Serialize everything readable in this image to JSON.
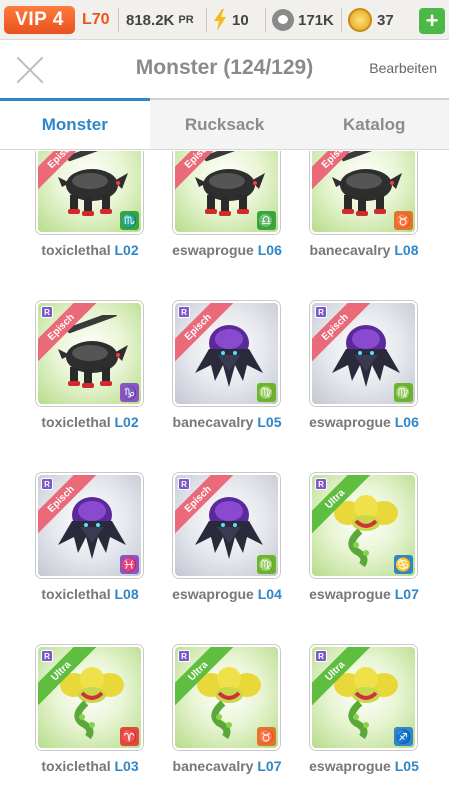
{
  "statusbar": {
    "vip": "VIP 4",
    "level": "L70",
    "power": "818.2K",
    "power_unit": "PR",
    "energy": "10",
    "food": "171K",
    "coins": "37",
    "add_label": "+"
  },
  "header": {
    "title": "Monster (124/129)",
    "edit_label": "Bearbeiten"
  },
  "tabs": [
    {
      "label": "Monster",
      "active": true
    },
    {
      "label": "Rucksack",
      "active": false
    },
    {
      "label": "Katalog",
      "active": false
    }
  ],
  "monsters": [
    {
      "name": "toxiclethal",
      "level": "L02",
      "rarity": "Episch",
      "bg": "green",
      "type": "beast",
      "zodiac": "♏",
      "zodiac_color": "#3aa63a"
    },
    {
      "name": "eswaprogue",
      "level": "L06",
      "rarity": "Episch",
      "bg": "green",
      "type": "beast",
      "zodiac": "♎",
      "zodiac_color": "#3aa63a"
    },
    {
      "name": "banecavalry",
      "level": "L08",
      "rarity": "Episch",
      "bg": "green",
      "type": "beast",
      "zodiac": "♉",
      "zodiac_color": "#e0762a"
    },
    {
      "name": "toxiclethal",
      "level": "L02",
      "rarity": "Episch",
      "bg": "green",
      "type": "beast",
      "zodiac": "♑",
      "zodiac_color": "#8a55c0"
    },
    {
      "name": "banecavalry",
      "level": "L05",
      "rarity": "Episch",
      "bg": "gray",
      "type": "wraith",
      "zodiac": "♍",
      "zodiac_color": "#6bb52a"
    },
    {
      "name": "eswaprogue",
      "level": "L06",
      "rarity": "Episch",
      "bg": "gray",
      "type": "wraith",
      "zodiac": "♍",
      "zodiac_color": "#6bb52a"
    },
    {
      "name": "toxiclethal",
      "level": "L08",
      "rarity": "Episch",
      "bg": "gray",
      "type": "wraith",
      "zodiac": "♓",
      "zodiac_color": "#8a55c0"
    },
    {
      "name": "eswaprogue",
      "level": "L04",
      "rarity": "Episch",
      "bg": "gray",
      "type": "wraith",
      "zodiac": "♍",
      "zodiac_color": "#6bb52a"
    },
    {
      "name": "eswaprogue",
      "level": "L07",
      "rarity": "Ultra",
      "bg": "green",
      "type": "dragon",
      "zodiac": "♋",
      "zodiac_color": "#2f86c9"
    },
    {
      "name": "toxiclethal",
      "level": "L03",
      "rarity": "Ultra",
      "bg": "green",
      "type": "dragon",
      "zodiac": "♈",
      "zodiac_color": "#e04a3a"
    },
    {
      "name": "banecavalry",
      "level": "L07",
      "rarity": "Ultra",
      "bg": "green",
      "type": "dragon",
      "zodiac": "♉",
      "zodiac_color": "#e0762a"
    },
    {
      "name": "eswaprogue",
      "level": "L05",
      "rarity": "Ultra",
      "bg": "green",
      "type": "dragon",
      "zodiac": "♐",
      "zodiac_color": "#2f86c9"
    }
  ],
  "icons": {
    "close": "close-icon",
    "energy": "lightning-icon",
    "food": "paw-icon",
    "coin": "coin-icon",
    "add": "plus-icon"
  }
}
